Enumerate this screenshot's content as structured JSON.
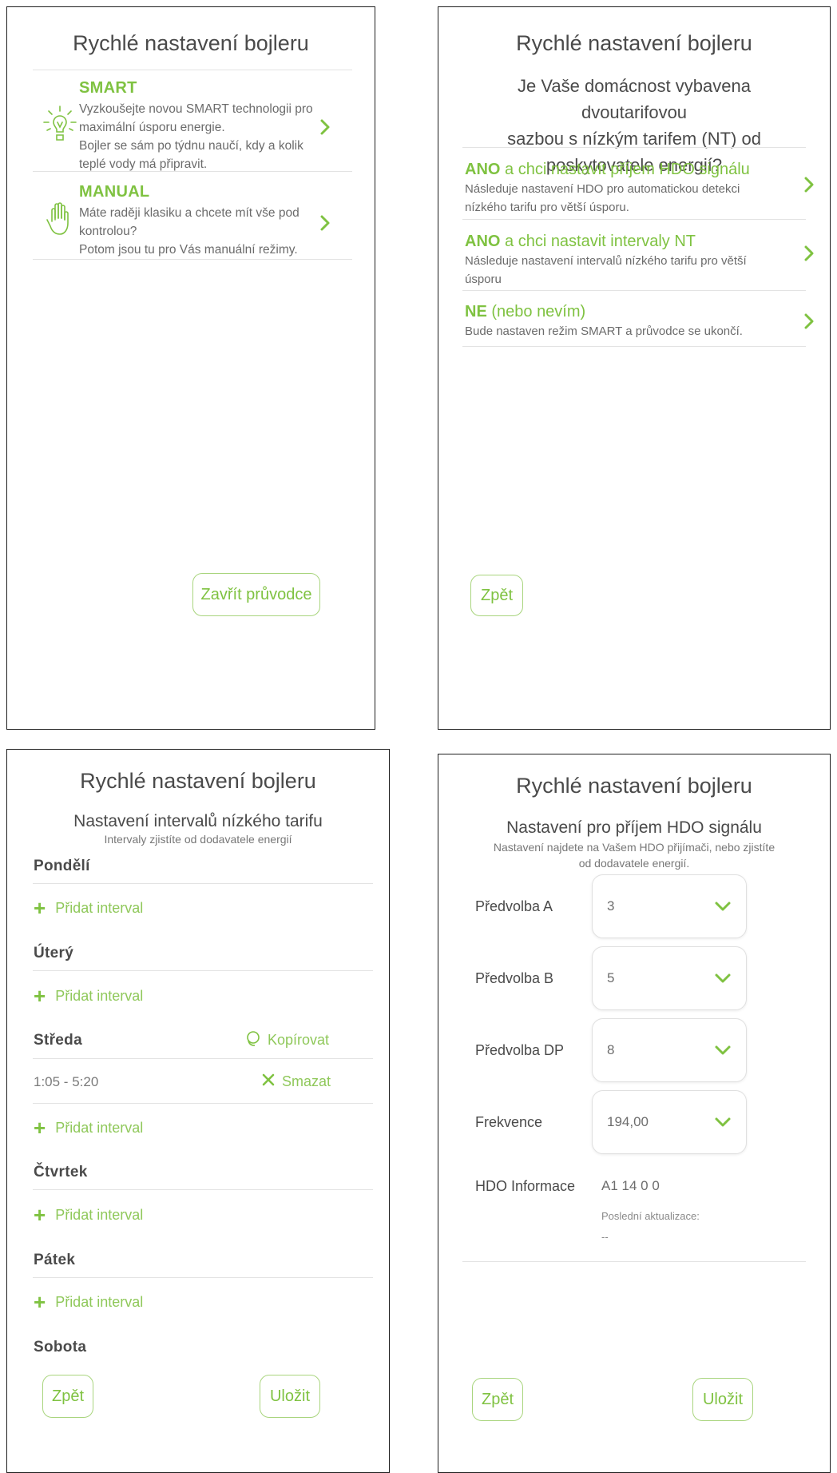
{
  "colors": {
    "accent": "#7fc241",
    "text": "#4a4a4a",
    "muted": "#6b6b6b",
    "divider": "#e3e3e3"
  },
  "common": {
    "title": "Rychlé nastavení bojleru",
    "back_label": "Zpět",
    "save_label": "Uložit"
  },
  "screen1": {
    "options": [
      {
        "title": "SMART",
        "icon": "lightbulb-icon",
        "lines": [
          "Vyzkoušejte novou SMART technologii pro",
          "maximální úsporu energie.",
          "Bojler se sám po týdnu naučí, kdy a kolik",
          "teplé vody má připravit."
        ]
      },
      {
        "title": "MANUAL",
        "icon": "hand-icon",
        "lines": [
          "Máte raději klasiku a chcete mít vše pod",
          "kontrolou?",
          "Potom jsou tu pro Vás manuální režimy."
        ]
      }
    ],
    "close_label": "Zavřít průvodce"
  },
  "screen2": {
    "question_lines": [
      "Je Vaše domácnost vybavena dvoutarifovou",
      "sazbou s nízkým tarifem (NT) od",
      "poskytovatele energií?"
    ],
    "answers": [
      {
        "bold": "ANO",
        "rest": " a chci nastavit příjem HDO signálu",
        "lines": [
          "Následuje nastavení HDO pro automatickou detekci",
          "nízkého tarifu pro větší úsporu."
        ]
      },
      {
        "bold": "ANO",
        "rest": " a chci nastavit intervaly NT",
        "lines": [
          "Následuje nastavení intervalů nízkého tarifu pro větší",
          "úsporu"
        ]
      },
      {
        "bold": "NE",
        "rest": " (nebo nevím)",
        "lines": [
          "Bude nastaven režim SMART a průvodce se ukončí."
        ]
      }
    ]
  },
  "screen3": {
    "subtitle": "Nastavení intervalů nízkého tarifu",
    "hint": "Intervaly zjistíte od dodavatele energií",
    "add_label": "Přidat interval",
    "copy_label": "Kopírovat",
    "delete_label": "Smazat",
    "days": [
      "Pondělí",
      "Úterý",
      "Středa",
      "Čtvrtek",
      "Pátek",
      "Sobota"
    ],
    "interval": "1:05 - 5:20"
  },
  "screen4": {
    "subtitle": "Nastavení pro příjem HDO signálu",
    "hint_lines": [
      "Nastavení najdete na Vašem HDO přijímači, nebo zjistíte",
      "od dodavatele energií."
    ],
    "fields": [
      {
        "label": "Předvolba A",
        "value": "3"
      },
      {
        "label": "Předvolba B",
        "value": "5"
      },
      {
        "label": "Předvolba DP",
        "value": "8"
      },
      {
        "label": "Frekvence",
        "value": "194,00"
      }
    ],
    "info_label": "HDO Informace",
    "info_value": "A1 14 0 0",
    "last_update_label": "Poslední aktualizace:",
    "last_update_value": "--"
  }
}
